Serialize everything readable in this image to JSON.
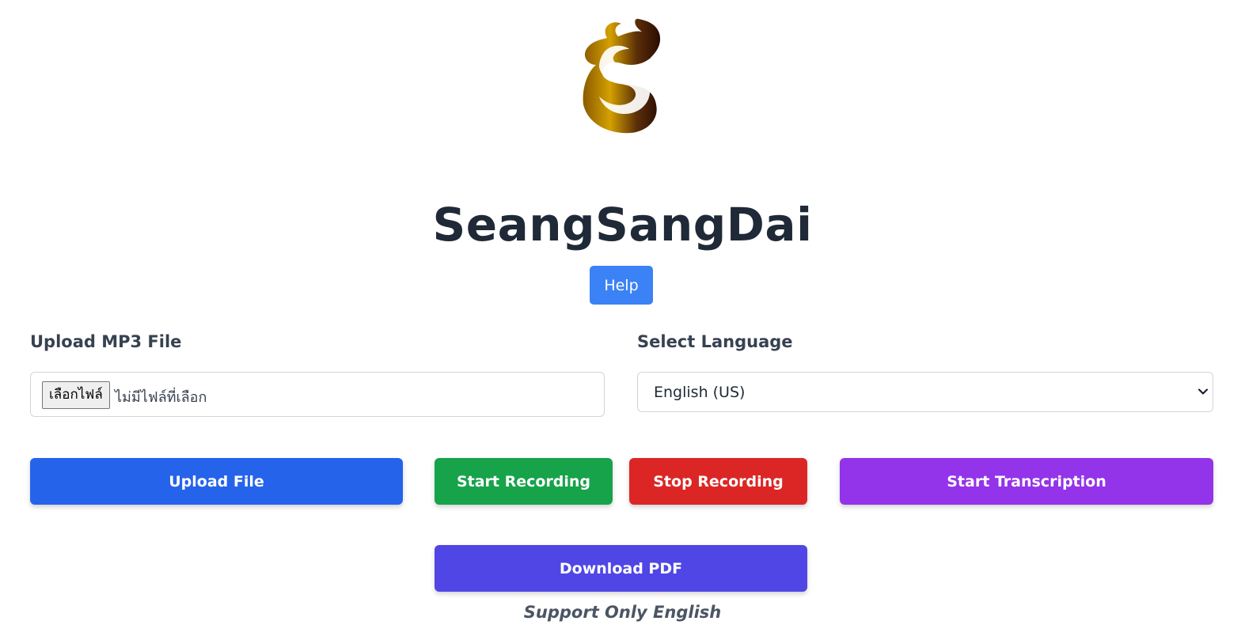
{
  "header": {
    "title": "SeangSangDai",
    "help_label": "Help"
  },
  "upload": {
    "label": "Upload MP3 File",
    "choose_button": "เลือกไฟล์",
    "no_file_text": "ไม่มีไฟล์ที่เลือก"
  },
  "language": {
    "label": "Select Language",
    "selected": "English (US)"
  },
  "actions": {
    "upload_file": "Upload File",
    "start_recording": "Start Recording",
    "stop_recording": "Stop Recording",
    "start_transcription": "Start Transcription",
    "download_pdf": "Download PDF"
  },
  "footer": {
    "support_note": "Support Only English"
  },
  "colors": {
    "help": "#3b82f6",
    "upload": "#2563eb",
    "start_recording": "#16a34a",
    "stop_recording": "#dc2626",
    "start_transcription": "#9333ea",
    "download_pdf": "#4f46e5"
  },
  "icons": {
    "logo": "gold-s-logo",
    "select_arrow": "chevron-down-icon"
  }
}
